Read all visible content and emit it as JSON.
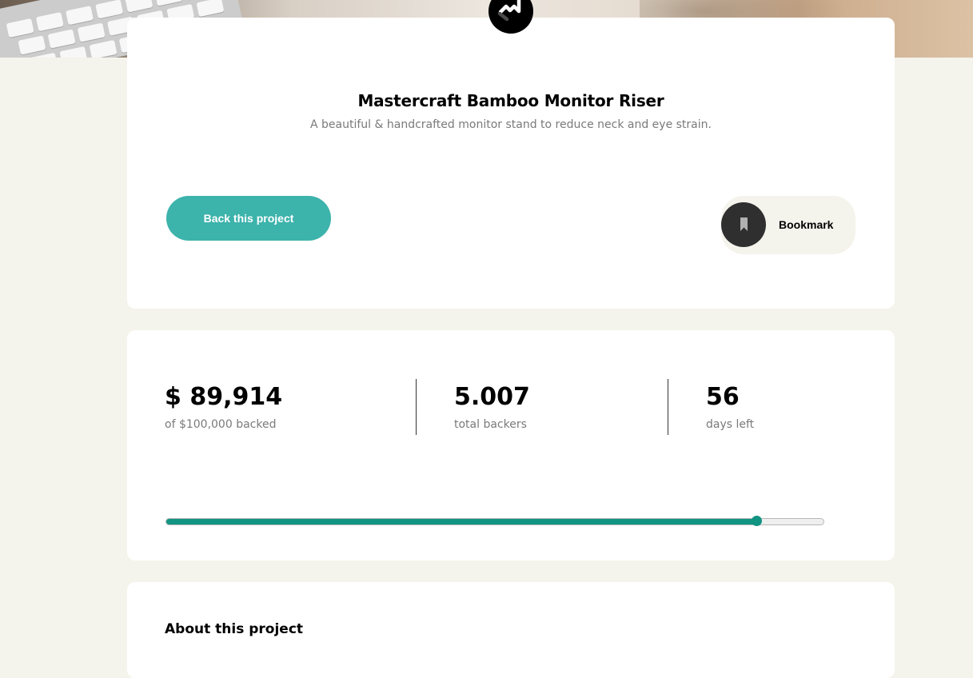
{
  "brand": {
    "logo_icon": "mastercraft-logo-icon"
  },
  "project": {
    "title": "Mastercraft Bamboo Monitor Riser",
    "description": "A beautiful & handcrafted monitor stand to reduce neck and eye strain."
  },
  "actions": {
    "back_label": "Back this project",
    "bookmark_label": "Bookmark",
    "bookmark_icon": "bookmark-icon"
  },
  "stats": {
    "backed_value": "$ 89,914",
    "backed_label": "of $100,000 backed",
    "backers_value": "5.007",
    "backers_label": "total backers",
    "days_value": "56",
    "days_label": "days left"
  },
  "progress": {
    "fraction": 0.8991
  },
  "about": {
    "title": "About this project"
  },
  "colors": {
    "page_background": "#f4f3ec",
    "primary_button": "#3cb3ab",
    "progress_fill": "#119482",
    "bookmark_circle": "#2f2f2f"
  }
}
